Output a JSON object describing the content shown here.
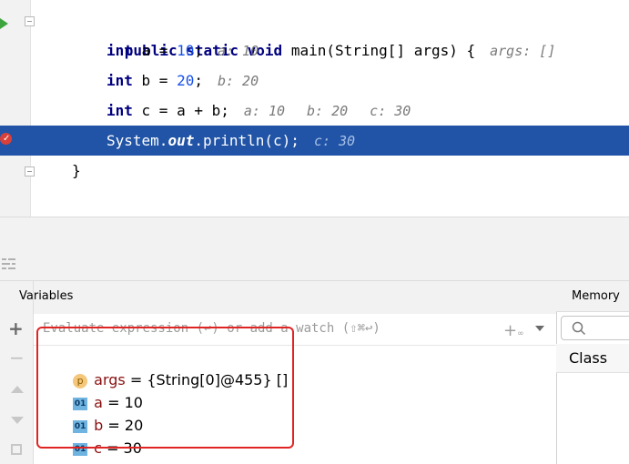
{
  "editor": {
    "lines": [
      {
        "code": "public static void main(String[] args) {",
        "hint": "args: []"
      },
      {
        "code": "int a = 10;",
        "hint": "a: 10"
      },
      {
        "code": "int b = 20;",
        "hint": "b: 20"
      },
      {
        "code": "int c = a + b;",
        "hints": [
          "a: 10",
          "b: 20",
          "c: 30"
        ]
      },
      {
        "code": "System.out.println(c);",
        "hint": "c: 30"
      },
      {
        "code": "}"
      }
    ],
    "highlighted_line_color": "#2154a6"
  },
  "debugger": {
    "variables_title": "Variables",
    "eval_placeholder": "Evaluate expression (↩) or add a watch (⇧⌘↩)",
    "variables": [
      {
        "badge": "p",
        "name": "args",
        "value": "= {String[0]@455} []"
      },
      {
        "badge": "01",
        "name": "a",
        "value": "= 10"
      },
      {
        "badge": "01",
        "name": "b",
        "value": "= 20"
      },
      {
        "badge": "01",
        "name": "c",
        "value": "= 30"
      }
    ]
  },
  "memory": {
    "tab_label": "Memory",
    "class_header": "Class"
  },
  "icons": [
    "run-icon",
    "breakpoint-icon",
    "fold-icon",
    "layout-icon",
    "plus-icon",
    "minus-icon",
    "up-arrow-icon",
    "down-arrow-icon",
    "copy-icon",
    "add-watch-icon",
    "dropdown-icon",
    "search-icon"
  ],
  "colors": {
    "annotation": "#e02424",
    "accent": "#2154a6"
  }
}
